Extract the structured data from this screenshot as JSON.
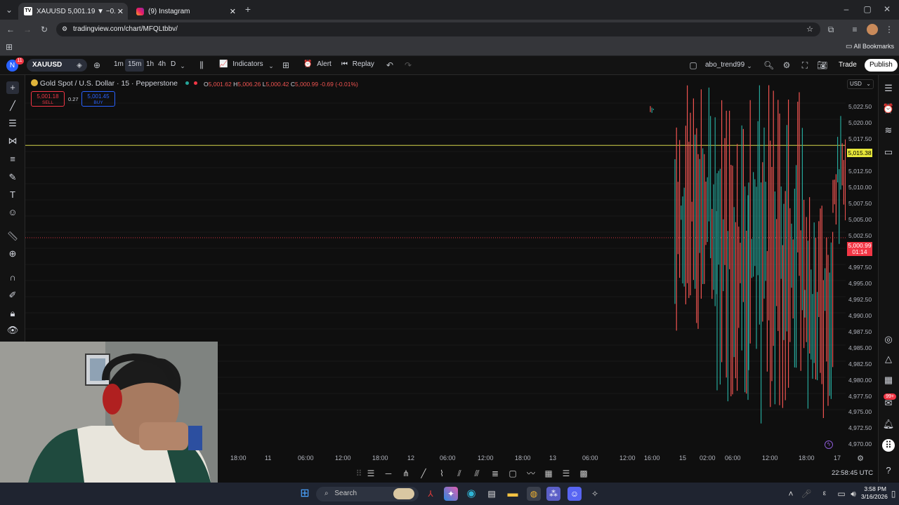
{
  "browser": {
    "tabs": [
      {
        "title": "XAUUSD 5,001.19 ▼ −0.1% ab",
        "icon": "tradingview-icon"
      },
      {
        "title": "(9) Instagram",
        "icon": "instagram-icon"
      }
    ],
    "url": "tradingview.com/chart/MFQLtbbv/",
    "bookmarks_label": "All Bookmarks"
  },
  "toolbar": {
    "symbol": "XAUUSD",
    "avatar_letter": "N",
    "avatar_badge": "11",
    "timeframes": [
      "1m",
      "15m",
      "1h",
      "4h",
      "D"
    ],
    "selected_timeframe": "15m",
    "indicators_label": "Indicators",
    "alert_label": "Alert",
    "replay_label": "Replay",
    "layout_name": "abo_trend99",
    "trade_label": "Trade",
    "publish_label": "Publish"
  },
  "legend": {
    "title": "Gold Spot / U.S. Dollar · 15 · Pepperstone",
    "o_label": "O",
    "o_value": "5,001.62",
    "h_label": "H",
    "h_value": "5,006.26",
    "l_label": "L",
    "l_value": "5,000.42",
    "c_label": "C",
    "c_value": "5,000.99",
    "change": "-0.69 (-0.01%)"
  },
  "order": {
    "sell_price": "5,001.18",
    "sell_label": "SELL",
    "spread": "0.27",
    "buy_price": "5,001.45",
    "buy_label": "BUY"
  },
  "price_axis": {
    "currency": "USD",
    "labels": [
      "5,022.50",
      "5,020.00",
      "5,017.50",
      "5,012.50",
      "5,010.00",
      "5,007.50",
      "5,005.00",
      "5,002.50",
      "4,997.50",
      "4,995.00",
      "4,992.50",
      "4,990.00",
      "4,987.50",
      "4,985.00",
      "4,982.50",
      "4,980.00",
      "4,977.50",
      "4,975.00",
      "4,972.50",
      "4,970.00"
    ],
    "hline_price": "5,015.38",
    "current_price": "5,000.99",
    "countdown": "01:14"
  },
  "time_axis": {
    "labels": [
      "18:00",
      "11",
      "06:00",
      "12:00",
      "18:00",
      "12",
      "06:00",
      "12:00",
      "18:00",
      "13",
      "06:00",
      "12:00",
      "16:00",
      "15",
      "02:00",
      "06:00",
      "12:00",
      "18:00",
      "17"
    ],
    "clock": "22:58:45 UTC"
  },
  "taskbar": {
    "search_placeholder": "Search",
    "time": "3:58 PM",
    "date": "3/16/2026",
    "notif_badge": "99+"
  },
  "colors": {
    "up": "#26a69a",
    "down": "#ef5350",
    "hline": "#d4d44a",
    "price_tag": "#f23645",
    "accent": "#2962ff"
  },
  "chart_data": {
    "type": "candlestick",
    "ylim": [
      4968,
      5025
    ],
    "hline": 5015.38,
    "last_price": 5000.99
  }
}
